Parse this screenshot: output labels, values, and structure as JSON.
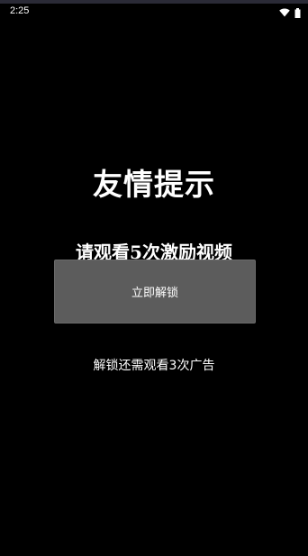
{
  "status_bar": {
    "time": "2:25",
    "icons": [
      "wifi-icon",
      "battery-icon"
    ]
  },
  "dialog": {
    "title": "友情提示",
    "instruction": "请观看5次激励视频",
    "unlock_button_label": "立即解锁",
    "remaining_text": "解锁还需观看3次广告"
  },
  "colors": {
    "background": "#000000",
    "button_background": "#5c5c5c",
    "text": "#ffffff"
  }
}
